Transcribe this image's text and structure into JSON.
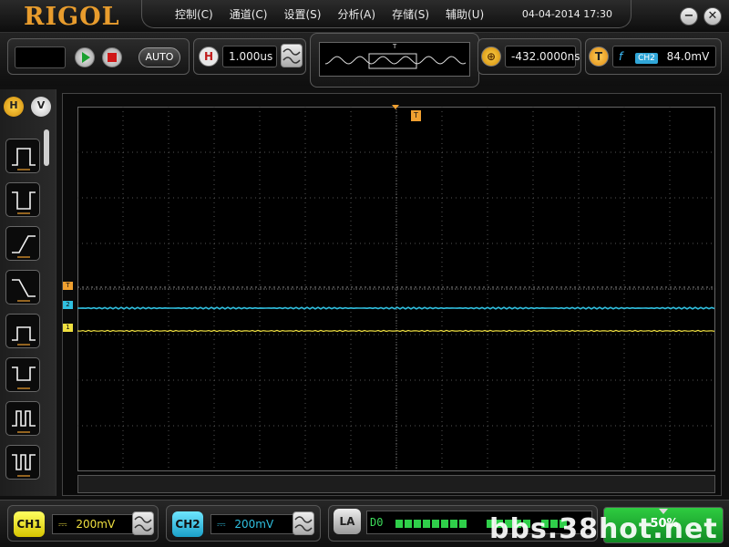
{
  "brand": "RIGOL",
  "menu": [
    "控制(C)",
    "通道(C)",
    "设置(S)",
    "分析(A)",
    "存储(S)",
    "辅助(U)"
  ],
  "datetime": "04-04-2014 17:30",
  "window_controls": {
    "minimize": "−",
    "close": "✕"
  },
  "toolbar": {
    "auto_label": "AUTO",
    "horizontal_tag": "H",
    "timebase": "1.000us",
    "zoom_offset": "-432.0000ns",
    "trigger_tag": "T",
    "trigger_slope": "f",
    "trigger_source": "CH2",
    "trigger_level": "84.0mV",
    "overview_marker": "T",
    "play_icon": "play-icon",
    "stop_icon": "stop-icon"
  },
  "side_tabs": {
    "h": "H",
    "v": "V"
  },
  "trigger_modes": [
    "pulse-positive-width",
    "pulse-negative-width",
    "rising-slope",
    "falling-slope",
    "runt-positive",
    "runt-negative",
    "window-positive",
    "window-negative"
  ],
  "screen": {
    "trigger_marker": "T",
    "trigger_level_marker": "T",
    "ch2_marker": "2",
    "ch1_marker": "1",
    "colors": {
      "ch1": "#f0e040",
      "ch2": "#30c0e0",
      "trigger": "#f0a030",
      "grid": "#555555"
    }
  },
  "bottom": {
    "ch1_label": "CH1",
    "ch1_coupling": "⎓",
    "ch1_scale": "200mV",
    "ch2_label": "CH2",
    "ch2_coupling": "⎓",
    "ch2_scale": "200mV",
    "la_label": "LA",
    "la_channel": "D0",
    "battery_percent": "50%",
    "watermark": "bbs.38hot.net"
  }
}
